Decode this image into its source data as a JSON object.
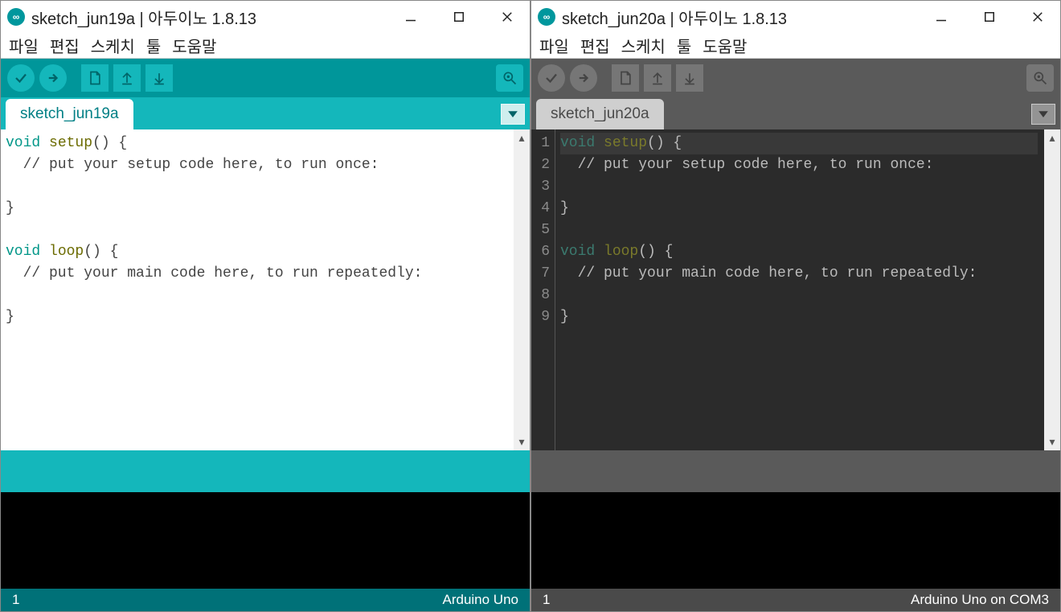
{
  "windows": [
    {
      "theme": "light",
      "title": "sketch_jun19a | 아두이노 1.8.13",
      "menu": [
        "파일",
        "편집",
        "스케치",
        "툴",
        "도움말"
      ],
      "tab": "sketch_jun19a",
      "code_tokens": [
        [
          {
            "t": "void ",
            "c": "kw-light"
          },
          {
            "t": "setup",
            "c": "fn-light"
          },
          {
            "t": "() {",
            "c": ""
          }
        ],
        [
          {
            "t": "  // put your setup code here, to run once:",
            "c": ""
          }
        ],
        [
          {
            "t": "",
            "c": ""
          }
        ],
        [
          {
            "t": "}",
            "c": ""
          }
        ],
        [
          {
            "t": "",
            "c": ""
          }
        ],
        [
          {
            "t": "void ",
            "c": "kw-light"
          },
          {
            "t": "loop",
            "c": "fn-light"
          },
          {
            "t": "() {",
            "c": ""
          }
        ],
        [
          {
            "t": "  // put your main code here, to run repeatedly:",
            "c": ""
          }
        ],
        [
          {
            "t": "",
            "c": ""
          }
        ],
        [
          {
            "t": "}",
            "c": ""
          }
        ]
      ],
      "show_gutter": false,
      "status_left": "1",
      "status_right": "Arduino Uno"
    },
    {
      "theme": "dark",
      "title": "sketch_jun20a | 아두이노 1.8.13",
      "menu": [
        "파일",
        "편집",
        "스케치",
        "툴",
        "도움말"
      ],
      "tab": "sketch_jun20a",
      "code_tokens": [
        [
          {
            "t": "void ",
            "c": "kw-dark"
          },
          {
            "t": "setup",
            "c": "fn-dark"
          },
          {
            "t": "() {",
            "c": ""
          }
        ],
        [
          {
            "t": "  // put your setup code here, to run once:",
            "c": ""
          }
        ],
        [
          {
            "t": "",
            "c": ""
          }
        ],
        [
          {
            "t": "}",
            "c": ""
          }
        ],
        [
          {
            "t": "",
            "c": ""
          }
        ],
        [
          {
            "t": "void ",
            "c": "kw-dark"
          },
          {
            "t": "loop",
            "c": "fn-dark"
          },
          {
            "t": "() {",
            "c": ""
          }
        ],
        [
          {
            "t": "  // put your main code here, to run repeatedly:",
            "c": ""
          }
        ],
        [
          {
            "t": "",
            "c": ""
          }
        ],
        [
          {
            "t": "}",
            "c": ""
          }
        ]
      ],
      "show_gutter": true,
      "gutter": [
        "1",
        "2",
        "3",
        "4",
        "5",
        "6",
        "7",
        "8",
        "9"
      ],
      "status_left": "1",
      "status_right": "Arduino Uno on COM3"
    }
  ],
  "icons": {
    "verify": "check-icon",
    "upload": "arrow-right-icon",
    "new": "file-icon",
    "open": "arrow-up-icon",
    "save": "arrow-down-icon",
    "serial": "magnify-icon"
  }
}
